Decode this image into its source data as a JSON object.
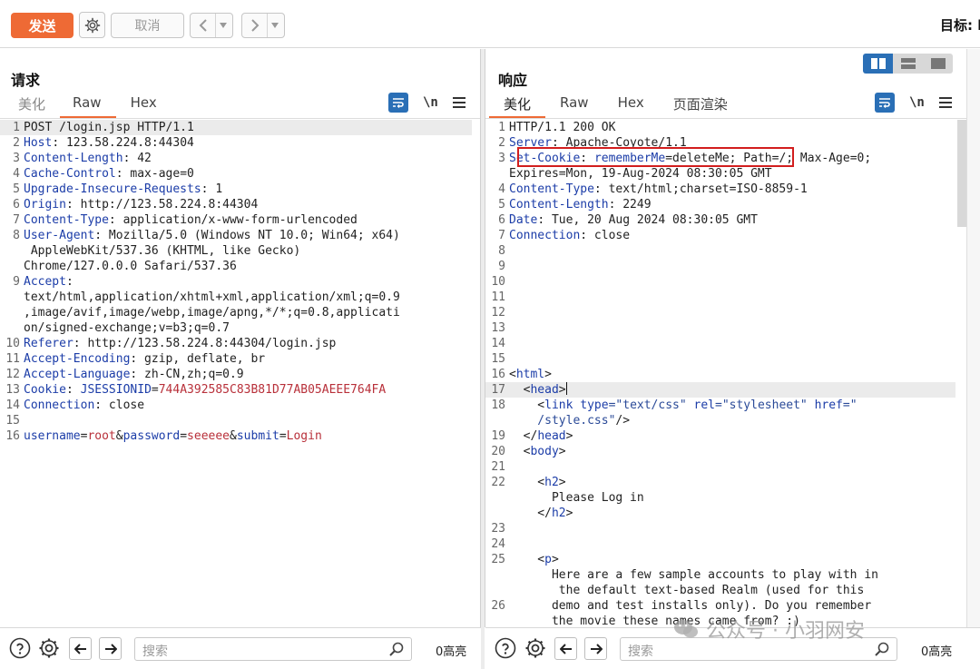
{
  "toolbar": {
    "send_label": "发送",
    "cancel_label": "取消",
    "target_label": "目标: h"
  },
  "request": {
    "title": "请求",
    "tabs": [
      "美化",
      "Raw",
      "Hex"
    ],
    "newline_label": "\\n",
    "lines": [
      {
        "n": "1",
        "segs": [
          {
            "t": "POST /login.jsp HTTP/1.1",
            "c": ""
          }
        ],
        "hl": true
      },
      {
        "n": "2",
        "segs": [
          {
            "t": "Host",
            "c": "hdr-name"
          },
          {
            "t": ": 123.58.224.8:44304",
            "c": ""
          }
        ]
      },
      {
        "n": "3",
        "segs": [
          {
            "t": "Content-Length",
            "c": "hdr-name"
          },
          {
            "t": ": 42",
            "c": ""
          }
        ]
      },
      {
        "n": "4",
        "segs": [
          {
            "t": "Cache-Control",
            "c": "hdr-name"
          },
          {
            "t": ": max-age=0",
            "c": ""
          }
        ]
      },
      {
        "n": "5",
        "segs": [
          {
            "t": "Upgrade-Insecure-Requests",
            "c": "hdr-name"
          },
          {
            "t": ": 1",
            "c": ""
          }
        ]
      },
      {
        "n": "6",
        "segs": [
          {
            "t": "Origin",
            "c": "hdr-name"
          },
          {
            "t": ": http://123.58.224.8:44304",
            "c": ""
          }
        ]
      },
      {
        "n": "7",
        "segs": [
          {
            "t": "Content-Type",
            "c": "hdr-name"
          },
          {
            "t": ": application/x-www-form-urlencoded",
            "c": ""
          }
        ]
      },
      {
        "n": "8",
        "segs": [
          {
            "t": "User-Agent",
            "c": "hdr-name"
          },
          {
            "t": ": Mozilla/5.0 (Windows NT 10.0; Win64; x64)",
            "c": ""
          }
        ]
      },
      {
        "n": "",
        "segs": [
          {
            "t": " AppleWebKit/537.36 (KHTML, like Gecko)",
            "c": ""
          }
        ]
      },
      {
        "n": "",
        "segs": [
          {
            "t": "Chrome/127.0.0.0 Safari/537.36",
            "c": ""
          }
        ]
      },
      {
        "n": "9",
        "segs": [
          {
            "t": "Accept",
            "c": "hdr-name"
          },
          {
            "t": ":",
            "c": ""
          }
        ]
      },
      {
        "n": "",
        "segs": [
          {
            "t": "text/html,application/xhtml+xml,application/xml;q=0.9",
            "c": ""
          }
        ]
      },
      {
        "n": "",
        "segs": [
          {
            "t": ",image/avif,image/webp,image/apng,*/*;q=0.8,applicati",
            "c": ""
          }
        ]
      },
      {
        "n": "",
        "segs": [
          {
            "t": "on/signed-exchange;v=b3;q=0.7",
            "c": ""
          }
        ]
      },
      {
        "n": "10",
        "segs": [
          {
            "t": "Referer",
            "c": "hdr-name"
          },
          {
            "t": ": http://123.58.224.8:44304/login.jsp",
            "c": ""
          }
        ]
      },
      {
        "n": "11",
        "segs": [
          {
            "t": "Accept-Encoding",
            "c": "hdr-name"
          },
          {
            "t": ": gzip, deflate, br",
            "c": ""
          }
        ]
      },
      {
        "n": "12",
        "segs": [
          {
            "t": "Accept-Language",
            "c": "hdr-name"
          },
          {
            "t": ": zh-CN,zh;q=0.9",
            "c": ""
          }
        ]
      },
      {
        "n": "13",
        "segs": [
          {
            "t": "Cookie",
            "c": "hdr-name"
          },
          {
            "t": ": ",
            "c": ""
          },
          {
            "t": "JSESSIONID",
            "c": "hdr-name"
          },
          {
            "t": "=",
            "c": ""
          },
          {
            "t": "744A392585C83B81D77AB05AEEE764FA",
            "c": "val-red"
          }
        ]
      },
      {
        "n": "14",
        "segs": [
          {
            "t": "Connection",
            "c": "hdr-name"
          },
          {
            "t": ": close",
            "c": ""
          }
        ]
      },
      {
        "n": "15",
        "segs": [
          {
            "t": "",
            "c": ""
          }
        ]
      },
      {
        "n": "16",
        "segs": [
          {
            "t": "username",
            "c": "hdr-name"
          },
          {
            "t": "=",
            "c": ""
          },
          {
            "t": "root",
            "c": "val-red"
          },
          {
            "t": "&",
            "c": ""
          },
          {
            "t": "password",
            "c": "hdr-name"
          },
          {
            "t": "=",
            "c": ""
          },
          {
            "t": "seeeee",
            "c": "val-red"
          },
          {
            "t": "&",
            "c": ""
          },
          {
            "t": "submit",
            "c": "hdr-name"
          },
          {
            "t": "=",
            "c": ""
          },
          {
            "t": "Login",
            "c": "val-red"
          }
        ]
      }
    ],
    "search_placeholder": "搜索",
    "highlight_count": "0高亮"
  },
  "response": {
    "title": "响应",
    "tabs": [
      "美化",
      "Raw",
      "Hex",
      "页面渲染"
    ],
    "newline_label": "\\n",
    "lines": [
      {
        "n": "1",
        "segs": [
          {
            "t": "HTTP/1.1 200 OK",
            "c": ""
          }
        ]
      },
      {
        "n": "2",
        "segs": [
          {
            "t": "Server",
            "c": "hdr-name"
          },
          {
            "t": ": Apache-Coyote/1.1",
            "c": ""
          }
        ]
      },
      {
        "n": "3",
        "segs": [
          {
            "t": "Set-Cookie",
            "c": "hdr-name"
          },
          {
            "t": ": ",
            "c": ""
          },
          {
            "t": "rememberMe",
            "c": "hdr-name"
          },
          {
            "t": "=deleteMe; Path=/; Max-Age=0;",
            "c": ""
          }
        ]
      },
      {
        "n": "",
        "segs": [
          {
            "t": "Expires=Mon, 19-Aug-2024 08:30:05 GMT",
            "c": ""
          }
        ]
      },
      {
        "n": "4",
        "segs": [
          {
            "t": "Content-Type",
            "c": "hdr-name"
          },
          {
            "t": ": text/html;charset=ISO-8859-1",
            "c": ""
          }
        ]
      },
      {
        "n": "5",
        "segs": [
          {
            "t": "Content-Length",
            "c": "hdr-name"
          },
          {
            "t": ": 2249",
            "c": ""
          }
        ]
      },
      {
        "n": "6",
        "segs": [
          {
            "t": "Date",
            "c": "hdr-name"
          },
          {
            "t": ": Tue, 20 Aug 2024 08:30:05 GMT",
            "c": ""
          }
        ]
      },
      {
        "n": "7",
        "segs": [
          {
            "t": "Connection",
            "c": "hdr-name"
          },
          {
            "t": ": close",
            "c": ""
          }
        ]
      },
      {
        "n": "8",
        "segs": [
          {
            "t": "",
            "c": ""
          }
        ]
      },
      {
        "n": "9",
        "segs": [
          {
            "t": "",
            "c": ""
          }
        ]
      },
      {
        "n": "10",
        "segs": [
          {
            "t": "",
            "c": ""
          }
        ]
      },
      {
        "n": "11",
        "segs": [
          {
            "t": "",
            "c": ""
          }
        ]
      },
      {
        "n": "12",
        "segs": [
          {
            "t": "",
            "c": ""
          }
        ]
      },
      {
        "n": "13",
        "segs": [
          {
            "t": "",
            "c": ""
          }
        ]
      },
      {
        "n": "14",
        "segs": [
          {
            "t": "",
            "c": ""
          }
        ]
      },
      {
        "n": "15",
        "segs": [
          {
            "t": "",
            "c": ""
          }
        ]
      },
      {
        "n": "16",
        "segs": [
          {
            "t": "<",
            "c": ""
          },
          {
            "t": "html",
            "c": "tag"
          },
          {
            "t": ">",
            "c": ""
          }
        ]
      },
      {
        "n": "17",
        "segs": [
          {
            "t": "  <",
            "c": ""
          },
          {
            "t": "head",
            "c": "tag"
          },
          {
            "t": ">",
            "c": ""
          }
        ],
        "hl": true,
        "caret": true
      },
      {
        "n": "18",
        "segs": [
          {
            "t": "    <",
            "c": ""
          },
          {
            "t": "link",
            "c": "tag"
          },
          {
            "t": " ",
            "c": ""
          },
          {
            "t": "type",
            "c": "attr"
          },
          {
            "t": "=\"text/css\" ",
            "c": "str"
          },
          {
            "t": "rel",
            "c": "attr"
          },
          {
            "t": "=\"stylesheet\" ",
            "c": "str"
          },
          {
            "t": "href",
            "c": "attr"
          },
          {
            "t": "=\"",
            "c": "str"
          }
        ]
      },
      {
        "n": "",
        "segs": [
          {
            "t": "    /style.css\"",
            "c": "str"
          },
          {
            "t": "/>",
            "c": ""
          }
        ]
      },
      {
        "n": "19",
        "segs": [
          {
            "t": "  </",
            "c": ""
          },
          {
            "t": "head",
            "c": "tag"
          },
          {
            "t": ">",
            "c": ""
          }
        ]
      },
      {
        "n": "20",
        "segs": [
          {
            "t": "  <",
            "c": ""
          },
          {
            "t": "body",
            "c": "tag"
          },
          {
            "t": ">",
            "c": ""
          }
        ]
      },
      {
        "n": "21",
        "segs": [
          {
            "t": "",
            "c": ""
          }
        ]
      },
      {
        "n": "22",
        "segs": [
          {
            "t": "    <",
            "c": ""
          },
          {
            "t": "h2",
            "c": "tag"
          },
          {
            "t": ">",
            "c": ""
          }
        ]
      },
      {
        "n": "",
        "segs": [
          {
            "t": "      Please Log in",
            "c": ""
          }
        ]
      },
      {
        "n": "",
        "segs": [
          {
            "t": "    </",
            "c": ""
          },
          {
            "t": "h2",
            "c": "tag"
          },
          {
            "t": ">",
            "c": ""
          }
        ]
      },
      {
        "n": "23",
        "segs": [
          {
            "t": "",
            "c": ""
          }
        ]
      },
      {
        "n": "24",
        "segs": [
          {
            "t": "",
            "c": ""
          }
        ]
      },
      {
        "n": "25",
        "segs": [
          {
            "t": "    <",
            "c": ""
          },
          {
            "t": "p",
            "c": "tag"
          },
          {
            "t": ">",
            "c": ""
          }
        ]
      },
      {
        "n": "",
        "segs": [
          {
            "t": "      Here are a few sample accounts to play with in",
            "c": ""
          }
        ]
      },
      {
        "n": "",
        "segs": [
          {
            "t": "       the default text-based Realm (used for this",
            "c": ""
          }
        ]
      },
      {
        "n": "26",
        "segs": [
          {
            "t": "      demo and test installs only). Do you remember",
            "c": ""
          }
        ]
      },
      {
        "n": "",
        "segs": [
          {
            "t": "      the movie these names came from? :)",
            "c": ""
          }
        ]
      }
    ],
    "search_placeholder": "搜索",
    "highlight_count": "0高亮"
  },
  "watermark": "公众号 · 小羽网安",
  "colors": {
    "accent": "#ee6a35",
    "header_name": "#1c3da8",
    "value_red": "#b8303a",
    "highlight_box": "#d21e1e"
  }
}
